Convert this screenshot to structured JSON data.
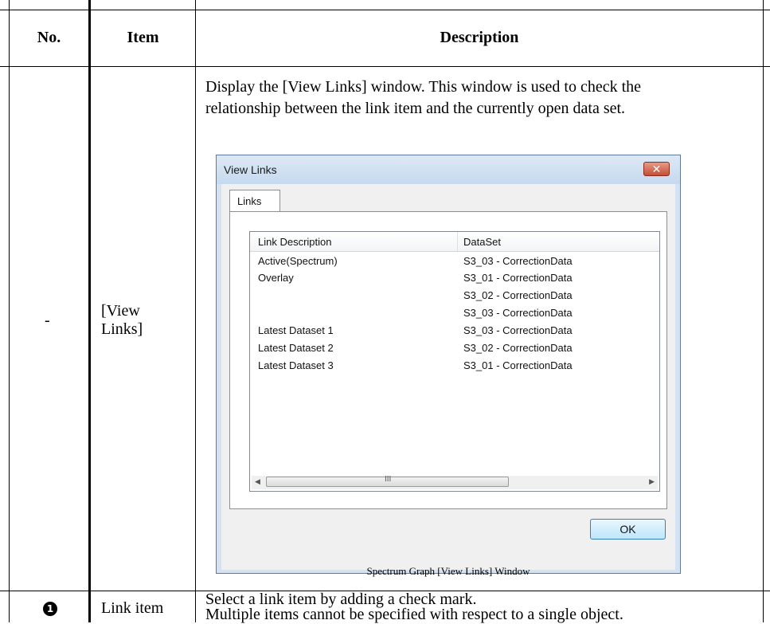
{
  "table": {
    "headers": {
      "no": "No.",
      "item": "Item",
      "description": "Description"
    },
    "rows": [
      {
        "no": "-",
        "item_line1": "[View",
        "item_line2": "Links]",
        "desc_line1": "Display the [View Links] window. This window is used to check the",
        "desc_line2": "relationship between the link item and the currently open data set.",
        "caption": "Spectrum Graph [View Links] Window"
      },
      {
        "no_badge": "1",
        "item": "Link item",
        "desc_line1": "Select a link item by adding a check mark.",
        "desc_line2": "Multiple items cannot be specified with respect to a single object."
      }
    ]
  },
  "dialog": {
    "title": "View Links",
    "close_glyph": "✕",
    "tab_label": "Links",
    "columns": [
      "Link Description",
      "DataSet"
    ],
    "rows": [
      {
        "desc": "Active(Spectrum)",
        "dataset": "S3_03 - CorrectionData"
      },
      {
        "desc": "Overlay",
        "dataset": "S3_01 - CorrectionData"
      },
      {
        "desc": "",
        "dataset": "S3_02 - CorrectionData"
      },
      {
        "desc": "",
        "dataset": "S3_03 - CorrectionData"
      },
      {
        "desc": "Latest Dataset 1",
        "dataset": "S3_03 - CorrectionData"
      },
      {
        "desc": "Latest Dataset 2",
        "dataset": "S3_02 - CorrectionData"
      },
      {
        "desc": "Latest Dataset 3",
        "dataset": "S3_01 - CorrectionData"
      }
    ],
    "scroll_left_glyph": "◀",
    "scroll_right_glyph": "▶",
    "scroll_grip": "III",
    "ok_label": "OK"
  }
}
